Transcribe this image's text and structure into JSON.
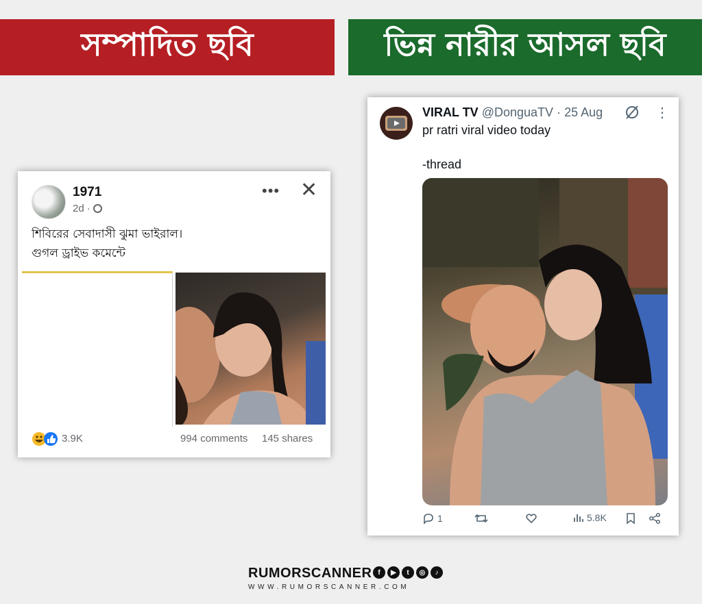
{
  "banners": {
    "left": "সম্পাদিত ছবি",
    "right": "ভিন্ন নারীর আসল ছবি"
  },
  "facebook_post": {
    "author": "1971",
    "time": "2d",
    "text_line1": "শিবিরের সেবাদাসী ঝুমা ভাইরাল।",
    "text_line2": "গুগল ড্রাইভ কমেন্টে",
    "reactions_count": "3.9K",
    "comments": "994 comments",
    "shares": "145 shares"
  },
  "tweet": {
    "display_name": "VIRAL TV",
    "handle": "@DonguaTV",
    "separator": "·",
    "date": "25 Aug",
    "text_line1": "pr ratri viral video today",
    "text_line2": "-thread",
    "replies": "1",
    "views": "5.8K"
  },
  "brand": {
    "name": "RUMORSCANNER",
    "url": "WWW.RUMORSCANNER.COM"
  },
  "colors": {
    "banner_left": "#b51f24",
    "banner_right": "#1b6b2c"
  }
}
